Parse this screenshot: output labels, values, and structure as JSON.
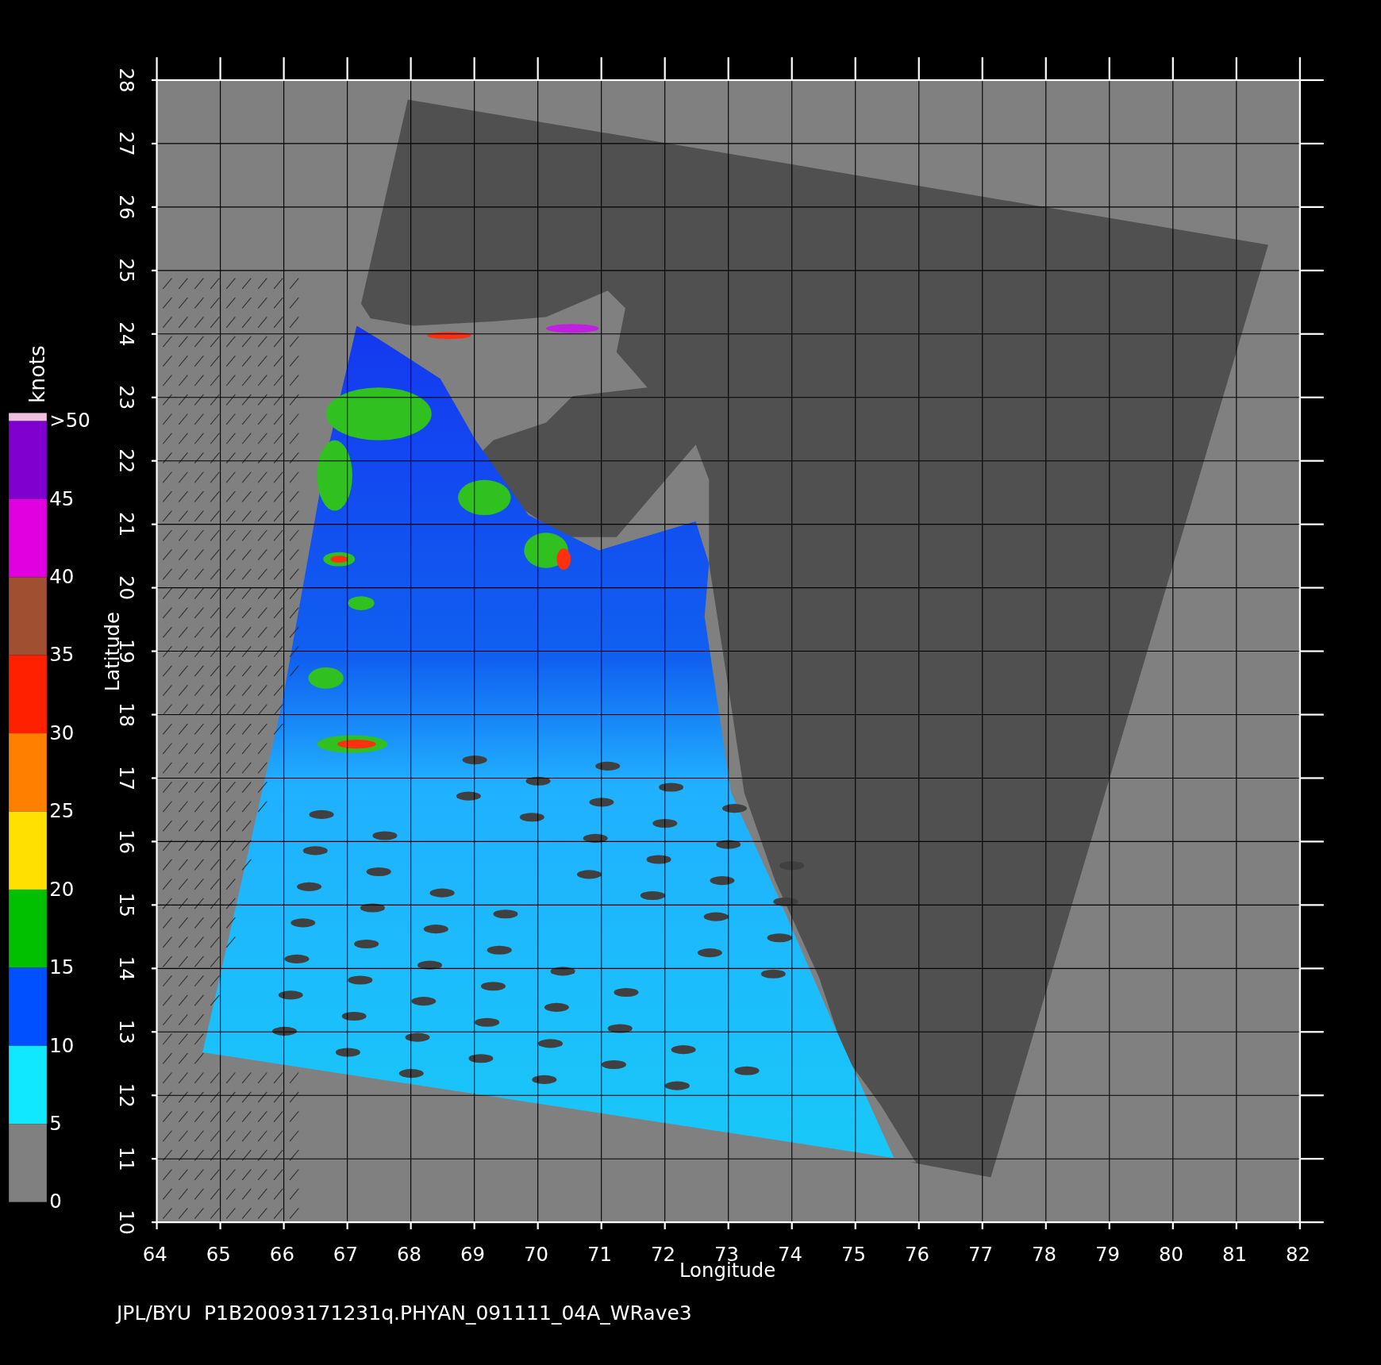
{
  "map": {
    "xlabel": "Longitude",
    "ylabel": "Latitude",
    "xticks": [
      "64",
      "65",
      "66",
      "67",
      "68",
      "69",
      "70",
      "71",
      "72",
      "73",
      "74",
      "75",
      "76",
      "77",
      "78",
      "79",
      "80",
      "81",
      "82"
    ],
    "yticks": [
      "10",
      "11",
      "12",
      "13",
      "14",
      "15",
      "16",
      "17",
      "18",
      "19",
      "20",
      "21",
      "22",
      "23",
      "24",
      "25",
      "26",
      "27",
      "28"
    ]
  },
  "colorbar": {
    "title": "knots",
    "labels": [
      ">50",
      "45",
      "40",
      "35",
      "30",
      "25",
      "20",
      "15",
      "10",
      "5",
      "0"
    ],
    "segments": [
      {
        "color": "#8000d0"
      },
      {
        "color": "#e000e0"
      },
      {
        "color": "#a05030"
      },
      {
        "color": "#ff2000"
      },
      {
        "color": "#ff8000"
      },
      {
        "color": "#ffe000"
      },
      {
        "color": "#00c000"
      },
      {
        "color": "#0050ff"
      },
      {
        "color": "#10e8ff"
      },
      {
        "color": "#808080"
      }
    ]
  },
  "caption": "JPL/BYU  P1B20093171231q.PHYAN_091111_04A_WRave3"
}
